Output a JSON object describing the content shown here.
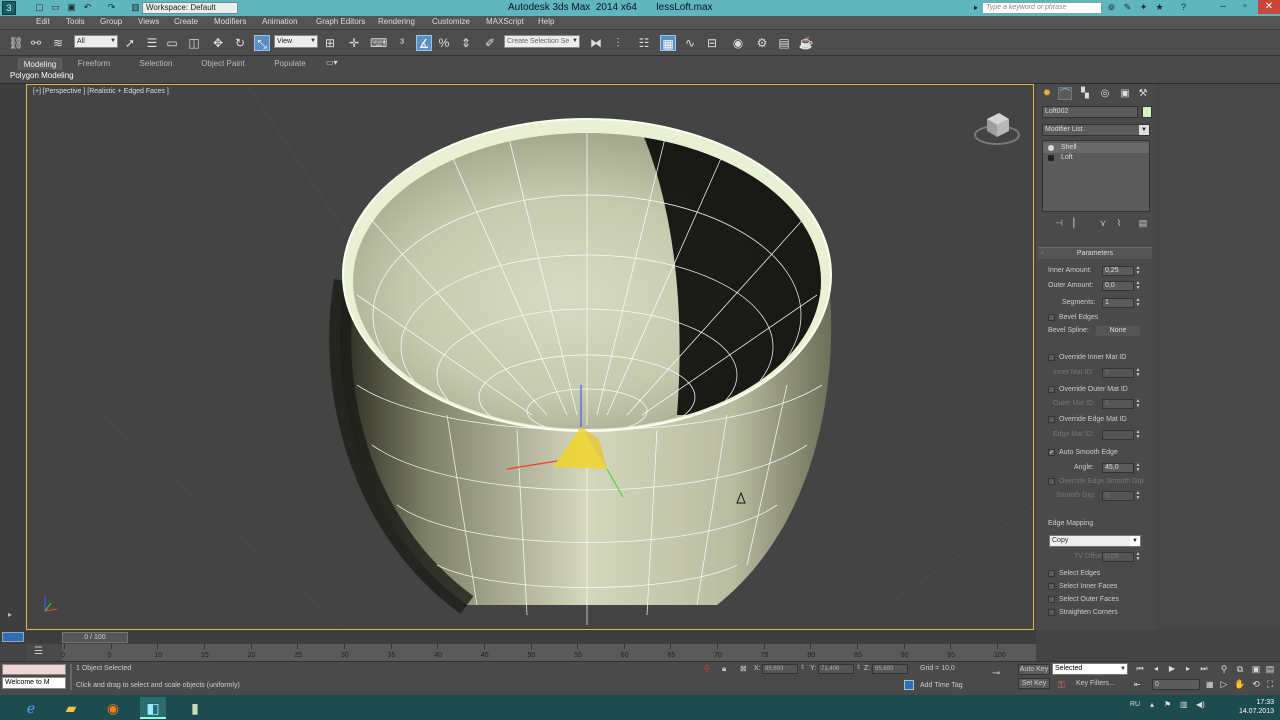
{
  "titlebar": {
    "title": "Autodesk 3ds Max  2014 x64       lessLoft.max",
    "workspace": "Workspace: Default",
    "search_placeholder": "Type a keyword or phrase",
    "logo": "3"
  },
  "menu": [
    "Edit",
    "Tools",
    "Group",
    "Views",
    "Create",
    "Modifiers",
    "Animation",
    "Graph Editors",
    "Rendering",
    "Customize",
    "MAXScript",
    "Help"
  ],
  "toolbar": {
    "filter": "All",
    "ref_coord": "View",
    "named_selection": "Create Selection Se"
  },
  "ribbon": {
    "tabs": [
      "Modeling",
      "Freeform",
      "Selection",
      "Object Paint",
      "Populate"
    ],
    "active_tab": "Modeling",
    "subpanel": "Polygon Modeling"
  },
  "viewport": {
    "label": "[+] [Perspective ] [Realistic + Edged Faces ]"
  },
  "command_panel": {
    "object_name": "Loft002",
    "object_color": "#d6f2c4",
    "modifier_list": "Modifier List",
    "stack": [
      "Shell",
      "Loft"
    ],
    "rollout_title": "Parameters",
    "params": {
      "inner_amount_label": "Inner Amount:",
      "inner_amount": "0,25",
      "outer_amount_label": "Outer Amount:",
      "outer_amount": "0,0",
      "segments_label": "Segments:",
      "segments": "1",
      "bevel_edges": "Bevel Edges",
      "bevel_spline_label": "Bevel Spline:",
      "bevel_spline_value": "None",
      "override_inner": "Override Inner Mat ID",
      "inner_mat_label": "Inner Mat ID:",
      "inner_mat": "1",
      "override_outer": "Override Outer Mat ID",
      "outer_mat_label": "Outer Mat ID:",
      "outer_mat": "1",
      "override_edge": "Override Edge Mat ID",
      "edge_mat_label": "Edge Mat ID:",
      "edge_mat": "",
      "auto_smooth": "Auto Smooth Edge",
      "angle_label": "Angle:",
      "angle": "45,0",
      "override_edge_smooth": "Override Edge Smooth Grp",
      "smooth_grp_label": "Smooth Grp:",
      "smooth_grp": "0",
      "edge_mapping_label": "Edge Mapping",
      "edge_mapping": "Copy",
      "tv_offset_label": "TV Offset:",
      "tv_offset": "0,05",
      "select_edges": "Select Edges",
      "select_inner": "Select Inner Faces",
      "select_outer": "Select Outer Faces",
      "straighten": "Straighten Corners"
    }
  },
  "timeline": {
    "frame": "0 / 100",
    "ticks": [
      "0",
      "5",
      "10",
      "15",
      "20",
      "25",
      "30",
      "35",
      "40",
      "45",
      "50",
      "55",
      "60",
      "65",
      "70",
      "75",
      "80",
      "85",
      "90",
      "95",
      "100"
    ]
  },
  "status": {
    "welcome": "Welcome to M",
    "selection": "1 Object Selected",
    "prompt": "Click and drag to select and scale objects (uniformly)",
    "x_label": "X:",
    "x": "95,693",
    "y_label": "Y:",
    "y": "71,406",
    "z_label": "Z:",
    "z": "95,693",
    "grid": "Grid = 10,0",
    "add_time_tag": "Add Time Tag",
    "auto_key": "Auto Key",
    "set_key": "Set Key",
    "selected": "Selected",
    "key_filters": "Key Filters...",
    "frame_value": "0"
  },
  "taskbar": {
    "lang": "RU",
    "time": "17:33",
    "date": "14.07.2013"
  }
}
